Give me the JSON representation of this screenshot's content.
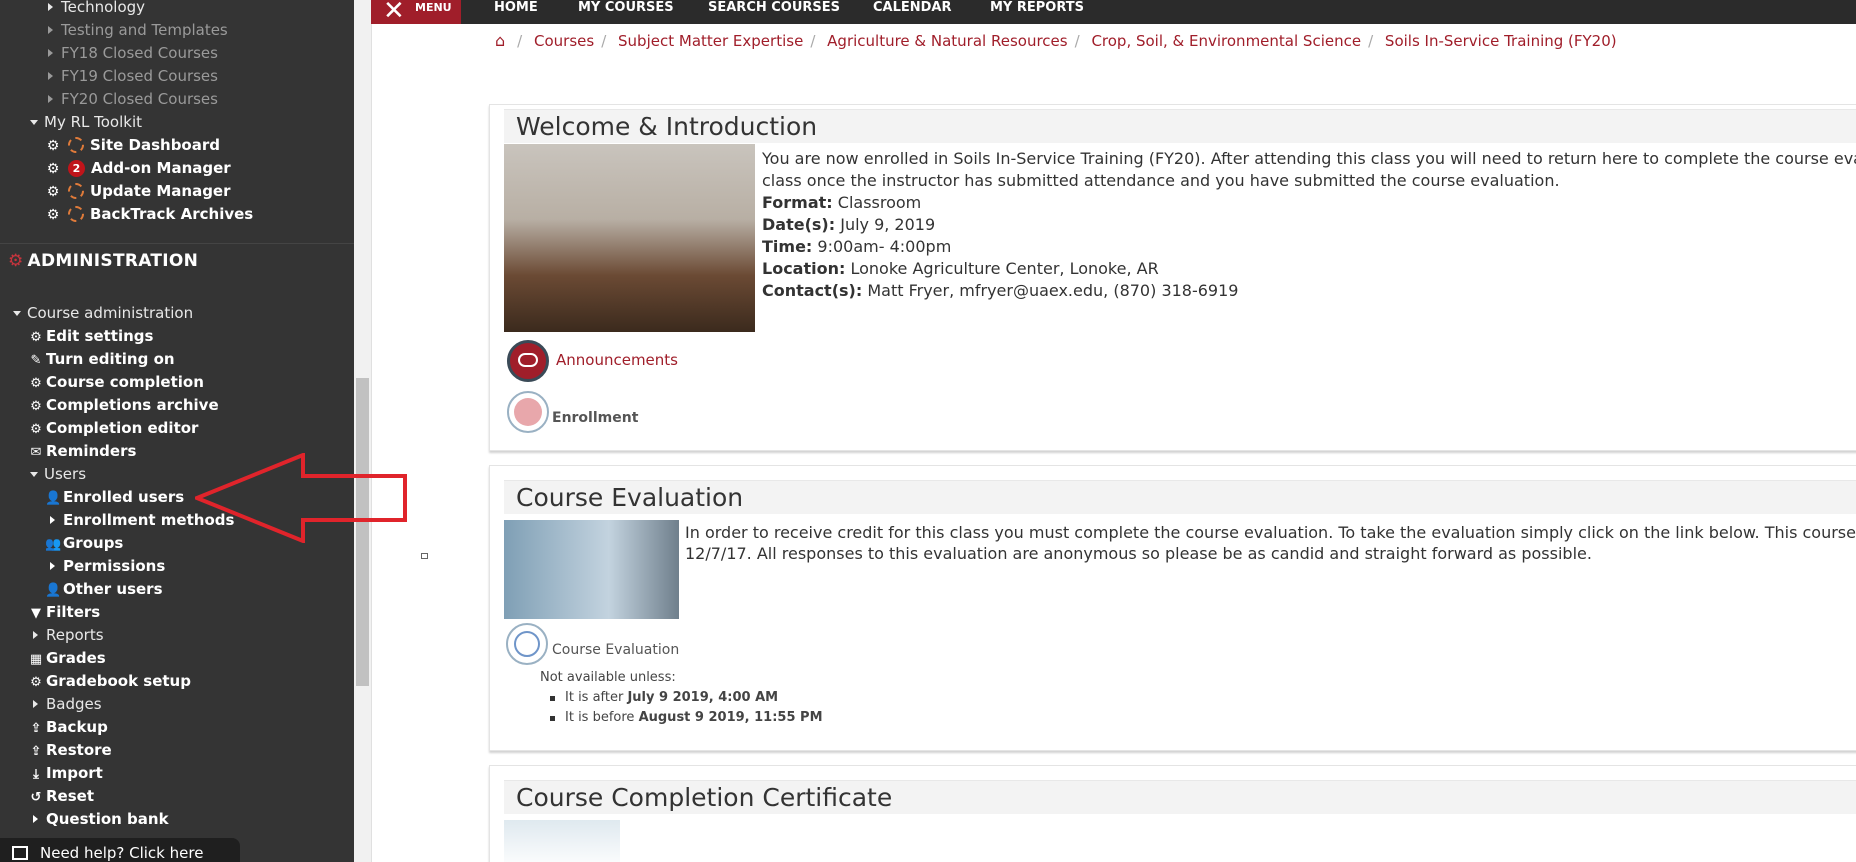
{
  "nav": {
    "menu_label": "MENU",
    "items": [
      "HOME",
      "MY COURSES",
      "SEARCH COURSES",
      "CALENDAR",
      "MY REPORTS"
    ]
  },
  "breadcrumb": [
    "Courses",
    "Subject Matter Expertise",
    "Agriculture & Natural Resources",
    "Crop, Soil, & Environmental Science",
    "Soils In-Service Training (FY20)"
  ],
  "sidebar": {
    "categories": [
      {
        "label": "Technology",
        "dim": false
      },
      {
        "label": "Testing and Templates",
        "dim": true
      },
      {
        "label": "FY18 Closed Courses",
        "dim": true
      },
      {
        "label": "FY19 Closed Courses",
        "dim": true
      },
      {
        "label": "FY20 Closed Courses",
        "dim": true
      }
    ],
    "toolkit_title": "My RL Toolkit",
    "toolkit_items": [
      "Site Dashboard",
      "Add-on Manager",
      "Update Manager",
      "BackTrack Archives"
    ],
    "addon_badge": "2",
    "admin_title": "ADMINISTRATION",
    "course_admin_label": "Course administration",
    "admin_items": {
      "edit_settings": "Edit settings",
      "turn_editing_on": "Turn editing on",
      "course_completion": "Course completion",
      "completions_archive": "Completions archive",
      "completion_editor": "Completion editor",
      "reminders": "Reminders",
      "users": "Users",
      "enrolled_users": "Enrolled users",
      "enrollment_methods": "Enrollment methods",
      "groups": "Groups",
      "permissions": "Permissions",
      "other_users": "Other users",
      "filters": "Filters",
      "reports": "Reports",
      "grades": "Grades",
      "gradebook_setup": "Gradebook setup",
      "badges": "Badges",
      "backup": "Backup",
      "restore": "Restore",
      "import": "Import",
      "reset": "Reset",
      "question_bank": "Question bank"
    },
    "help_label": "Need help? Click here"
  },
  "welcome": {
    "title": "Welcome & Introduction",
    "intro_line1": "You are now enrolled in Soils In-Service Training (FY20).  After attending this class you will need to return here to complete the course evaluation.",
    "intro_line2": "class once the instructor has submitted attendance and you have submitted the course evaluation.",
    "format_label": "Format:",
    "format_value": "Classroom",
    "dates_label": "Date(s):",
    "dates_value": "July 9, 2019",
    "time_label": "Time:",
    "time_value": "9:00am- 4:00pm",
    "location_label": "Location:",
    "location_value": "Lonoke Agriculture Center, Lonoke, AR",
    "contact_label": "Contact(s):",
    "contact_value": "Matt Fryer, mfryer@uaex.edu, (870) 318-6919",
    "announcements": "Announcements",
    "enrollment": "Enrollment"
  },
  "evaluation": {
    "title": "Course Evaluation",
    "text_line1": "In order to receive credit for this class you must complete the course evaluation.  To take the evaluation simply click on the link below. This course evaluatio",
    "text_line2": "12/7/17.  All responses to this evaluation are anonymous so please be as candid and straight forward as possible.",
    "link": "Course Evaluation",
    "restriction_title": "Not available unless:",
    "cond1_prefix": "It is after ",
    "cond1_value": "July 9 2019, 4:00 AM",
    "cond2_prefix": "It is before ",
    "cond2_value": "August 9 2019, 11:55 PM"
  },
  "certificate": {
    "title": "Course Completion Certificate"
  },
  "colors": {
    "brand": "#a01e2a",
    "sidebar_bg": "#343434",
    "nav_bg": "#2b2b2b",
    "arrow": "#e0242b"
  }
}
